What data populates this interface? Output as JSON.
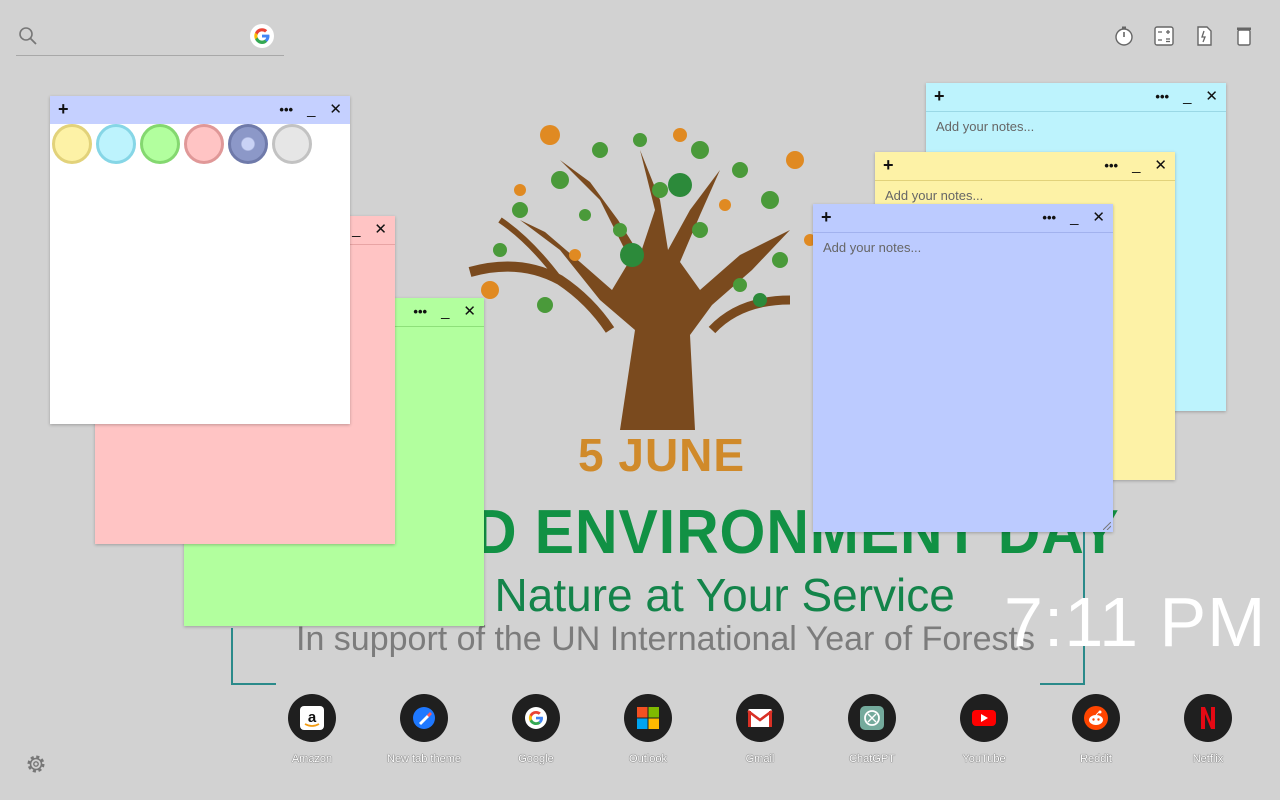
{
  "search": {
    "placeholder": ""
  },
  "top_tools": [
    "stopwatch-icon",
    "calculator-icon",
    "notes-icon",
    "trash-icon"
  ],
  "wallpaper": {
    "date": "5 JUNE",
    "title": "D ENVIRONMENT DAY",
    "subtitle": "s: Nature at Your Service",
    "support": "In support of the UN International Year of Forests"
  },
  "clock": {
    "time": "7:11 PM"
  },
  "notes": [
    {
      "name": "white-note",
      "placeholder": "",
      "color": "#ffffff",
      "bar_color": "#c5d0ff"
    },
    {
      "name": "pink-note",
      "placeholder": "",
      "color": "#ffc4c4"
    },
    {
      "name": "green-note",
      "placeholder": "",
      "color": "#b2ff9e"
    },
    {
      "name": "cyan-note",
      "placeholder": "Add your notes...",
      "color": "#bdf3fd"
    },
    {
      "name": "yellow-note",
      "placeholder": "Add your notes...",
      "color": "#fdf2a6"
    },
    {
      "name": "blue-note",
      "placeholder": "Add your notes...",
      "color": "#bccbff"
    }
  ],
  "note_controls": {
    "add": "+",
    "more": "•••",
    "minimize": "_",
    "close": "✕"
  },
  "color_swatches": [
    {
      "name": "yellow",
      "fill": "#fdf2a6",
      "ring": "#e2d27a"
    },
    {
      "name": "cyan",
      "fill": "#bdf3fd",
      "ring": "#86d6e6"
    },
    {
      "name": "green",
      "fill": "#b2ff9e",
      "ring": "#84d870"
    },
    {
      "name": "pink",
      "fill": "#ffc4c4",
      "ring": "#e09898"
    },
    {
      "name": "blue",
      "fill": "#8c98c8",
      "ring": "#6f7aaa"
    },
    {
      "name": "gray",
      "fill": "#e6e6e6",
      "ring": "#c2c2c2"
    }
  ],
  "dock": [
    {
      "label": "Amazon",
      "icon": "amazon-icon"
    },
    {
      "label": "New tab theme",
      "icon": "new-tab-theme-icon"
    },
    {
      "label": "Google",
      "icon": "google-icon"
    },
    {
      "label": "Outlook",
      "icon": "outlook-icon"
    },
    {
      "label": "Gmail",
      "icon": "gmail-icon"
    },
    {
      "label": "ChatGPT",
      "icon": "chatgpt-icon"
    },
    {
      "label": "YouTube",
      "icon": "youtube-icon"
    },
    {
      "label": "Reddit",
      "icon": "reddit-icon"
    },
    {
      "label": "Netflix",
      "icon": "netflix-icon"
    }
  ]
}
